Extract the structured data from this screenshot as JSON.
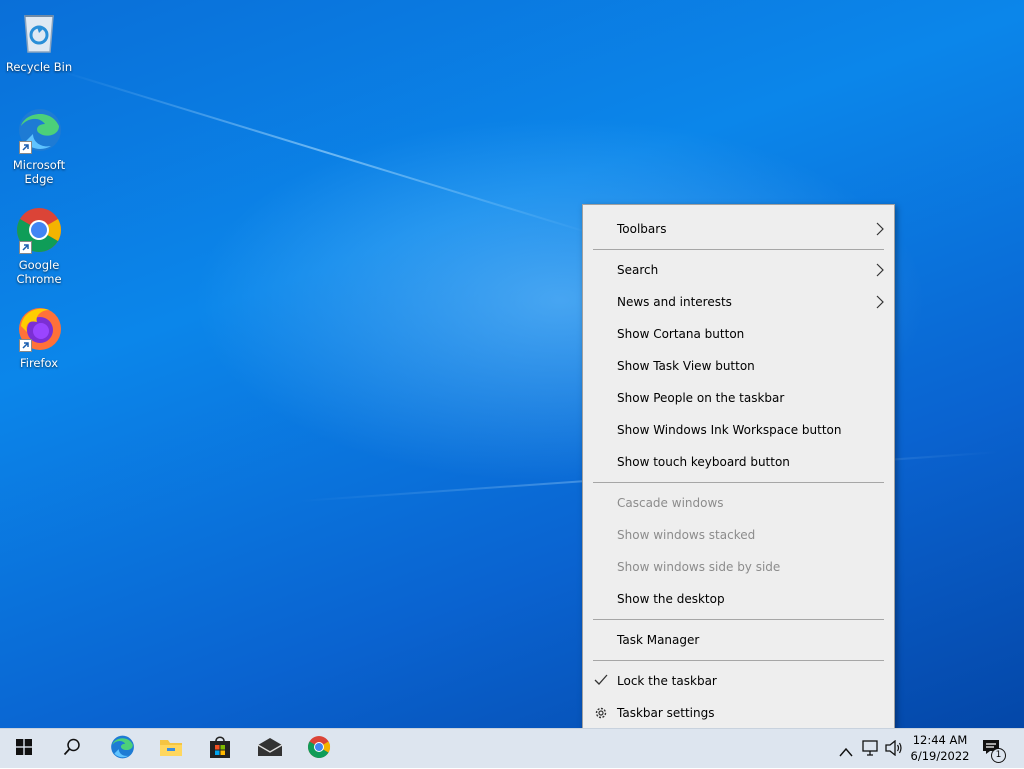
{
  "desktop": {
    "icons": [
      {
        "label": "Recycle Bin"
      },
      {
        "label": "Microsoft Edge"
      },
      {
        "label": "Google Chrome"
      },
      {
        "label": "Firefox"
      }
    ]
  },
  "context_menu": {
    "items": [
      {
        "label": "Toolbars",
        "submenu": true
      },
      {
        "label": "Search",
        "submenu": true
      },
      {
        "label": "News and interests",
        "submenu": true
      },
      {
        "label": "Show Cortana button"
      },
      {
        "label": "Show Task View button"
      },
      {
        "label": "Show People on the taskbar"
      },
      {
        "label": "Show Windows Ink Workspace button"
      },
      {
        "label": "Show touch keyboard button"
      },
      {
        "label": "Cascade windows",
        "disabled": true
      },
      {
        "label": "Show windows stacked",
        "disabled": true
      },
      {
        "label": "Show windows side by side",
        "disabled": true
      },
      {
        "label": "Show the desktop"
      },
      {
        "label": "Task Manager"
      },
      {
        "label": "Lock the taskbar",
        "checked": true
      },
      {
        "label": "Taskbar settings",
        "icon": "gear-icon"
      }
    ]
  },
  "taskbar": {
    "pinned": [
      "start-icon",
      "search-icon",
      "edge-icon",
      "file-explorer-icon",
      "store-icon",
      "mail-icon",
      "chrome-icon"
    ],
    "clock": {
      "time": "12:44 AM",
      "date": "6/19/2022"
    },
    "notification_count": "1"
  },
  "colors": {
    "accent": "#0078d7",
    "menu_bg": "#eeeeee",
    "disabled_text": "#8c8c8c"
  }
}
